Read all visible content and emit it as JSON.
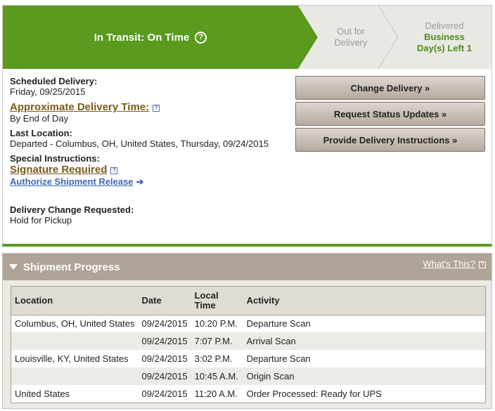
{
  "progress": {
    "current": "In Transit: On Time",
    "help_icon": "?",
    "next_line1": "Out for",
    "next_line2": "Delivery",
    "last_line1": "Delivered",
    "last_line2": "Business",
    "last_line3": "Day(s) Left 1",
    "colors": {
      "active": "#5a9a1e",
      "inactive": "#eae8e3",
      "days_left": "#4c8d1a"
    }
  },
  "details": {
    "scheduled_label": "Scheduled Delivery:",
    "scheduled_value": "Friday, 09/25/2015",
    "approx_label": "Approximate Delivery Time:",
    "approx_value": "By End of Day",
    "last_location_label": "Last Location:",
    "last_location_value": "Departed - Columbus, OH, United States, Thursday, 09/24/2015",
    "special_label": "Special Instructions:",
    "signature_label": "Signature Required",
    "authorize_link": "Authorize Shipment Release",
    "change_requested_label": "Delivery Change Requested:",
    "change_requested_value": "Hold for Pickup"
  },
  "actions": {
    "change_delivery": "Change Delivery »",
    "request_updates": "Request Status Updates »",
    "provide_instructions": "Provide Delivery Instructions »"
  },
  "shipment_progress": {
    "title": "Shipment Progress",
    "whats_this": "What's This?",
    "columns": {
      "location": "Location",
      "date": "Date",
      "time_line1": "Local",
      "time_line2": "Time",
      "activity": "Activity"
    },
    "rows": [
      {
        "location": "Columbus, OH, United States",
        "date": "09/24/2015",
        "time": "10:20 P.M.",
        "activity": "Departure Scan"
      },
      {
        "location": "",
        "date": "09/24/2015",
        "time": "7:07 P.M.",
        "activity": "Arrival Scan"
      },
      {
        "location": "Louisville, KY, United States",
        "date": "09/24/2015",
        "time": "3:02 P.M.",
        "activity": "Departure Scan"
      },
      {
        "location": "",
        "date": "09/24/2015",
        "time": "10:45 A.M.",
        "activity": "Origin Scan"
      },
      {
        "location": "United States",
        "date": "09/24/2015",
        "time": "11:20 A.M.",
        "activity": "Order Processed: Ready for UPS"
      }
    ]
  }
}
